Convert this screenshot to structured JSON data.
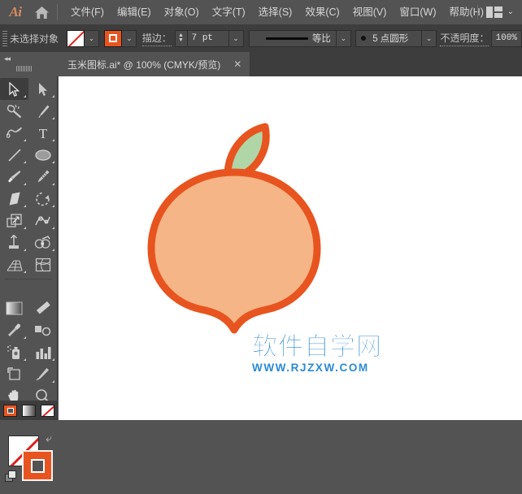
{
  "app": {
    "name": "Ai",
    "logo_color": "#d98b5f",
    "ui_bg": "#535353",
    "panel_bg": "#3d3d3d",
    "accent_orange": "#e8541f"
  },
  "menubar": {
    "home_icon": "home-icon",
    "items": [
      {
        "label": "文件(F)"
      },
      {
        "label": "编辑(E)"
      },
      {
        "label": "对象(O)"
      },
      {
        "label": "文字(T)"
      },
      {
        "label": "选择(S)"
      },
      {
        "label": "效果(C)"
      },
      {
        "label": "视图(V)"
      },
      {
        "label": "窗口(W)"
      },
      {
        "label": "帮助(H)"
      }
    ],
    "workspace_icon": "workspace-switcher-icon",
    "workspace_chevron": "⌄"
  },
  "controlbar": {
    "selection_status": "未选择对象",
    "fill_swatch": {
      "name": "fill-none",
      "value": "无"
    },
    "fill_dropdown": "⌄",
    "stroke_swatch": {
      "name": "stroke-orange",
      "value": "#e8541f"
    },
    "stroke_dropdown": "⌄",
    "stroke_label": "描边：",
    "stroke_weight": "7 pt",
    "stroke_weight_dropdown": "⌄",
    "profile_label": "等比",
    "profile_dropdown": "⌄",
    "brush_label": "5 点圆形",
    "brush_dropdown": "⌄",
    "opacity_label": "不透明度：",
    "opacity_value": "100%"
  },
  "tabbar": {
    "collapse_arrows": "◂◂",
    "document_tab": {
      "title": "玉米图标.ai* @ 100% (CMYK/预览)",
      "close": "✕"
    }
  },
  "toolpanel": {
    "tools": [
      {
        "name": "selection-tool",
        "label": "选择工具",
        "active": true,
        "has_flyout": true
      },
      {
        "name": "direct-selection-tool",
        "label": "直接选择工具",
        "active": false,
        "has_flyout": true
      },
      {
        "name": "magic-wand-tool",
        "label": "魔棒工具",
        "active": false,
        "has_flyout": false
      },
      {
        "name": "pen-tool",
        "label": "钢笔工具",
        "active": false,
        "has_flyout": true
      },
      {
        "name": "curvature-tool",
        "label": "曲率工具",
        "active": false,
        "has_flyout": true
      },
      {
        "name": "type-tool",
        "label": "文字工具",
        "active": false,
        "has_flyout": true
      },
      {
        "name": "line-segment-tool",
        "label": "直线段工具",
        "active": false,
        "has_flyout": true
      },
      {
        "name": "ellipse-tool",
        "label": "椭圆工具",
        "active": false,
        "has_flyout": true
      },
      {
        "name": "paintbrush-tool",
        "label": "画笔工具",
        "active": false,
        "has_flyout": true
      },
      {
        "name": "pencil-tool",
        "label": "铅笔工具",
        "active": false,
        "has_flyout": true
      },
      {
        "name": "eraser-tool",
        "label": "橡皮擦工具",
        "active": false,
        "has_flyout": true
      },
      {
        "name": "rotate-tool",
        "label": "旋转工具",
        "active": false,
        "has_flyout": true
      },
      {
        "name": "scale-tool",
        "label": "比例缩放工具",
        "active": false,
        "has_flyout": true
      },
      {
        "name": "width-tool",
        "label": "宽度工具",
        "active": false,
        "has_flyout": true
      },
      {
        "name": "free-transform-tool",
        "label": "自由变换工具",
        "active": false,
        "has_flyout": true
      },
      {
        "name": "shape-builder-tool",
        "label": "形状生成器工具",
        "active": false,
        "has_flyout": true
      },
      {
        "name": "perspective-grid-tool",
        "label": "透视网格工具",
        "active": false,
        "has_flyout": true
      },
      {
        "name": "mesh-tool",
        "label": "网格工具",
        "active": false,
        "has_flyout": false
      },
      {
        "name": "gradient-tool",
        "label": "渐变工具",
        "active": false,
        "has_flyout": false
      },
      {
        "name": "measure-tool",
        "label": "度量工具",
        "active": false,
        "has_flyout": false
      },
      {
        "name": "eyedropper-tool",
        "label": "吸管工具",
        "active": false,
        "has_flyout": true
      },
      {
        "name": "blend-tool",
        "label": "混合工具",
        "active": false,
        "has_flyout": false
      },
      {
        "name": "symbol-sprayer-tool",
        "label": "符号喷枪工具",
        "active": false,
        "has_flyout": true
      },
      {
        "name": "column-graph-tool",
        "label": "柱形图工具",
        "active": false,
        "has_flyout": true
      },
      {
        "name": "artboard-tool",
        "label": "画板工具",
        "active": false,
        "has_flyout": false
      },
      {
        "name": "slice-tool",
        "label": "切片工具",
        "active": false,
        "has_flyout": true
      },
      {
        "name": "hand-tool",
        "label": "抓手工具",
        "active": false,
        "has_flyout": true
      },
      {
        "name": "zoom-tool",
        "label": "缩放工具",
        "active": false,
        "has_flyout": false
      }
    ],
    "color_controls": {
      "fill": {
        "name": "fill-swatch",
        "value": "无"
      },
      "stroke": {
        "name": "stroke-swatch",
        "value": "#e8541f"
      },
      "swap_icon": "⤶",
      "default_icon": "default-fill-stroke-icon"
    },
    "mode_buttons": [
      {
        "name": "color-mode-button",
        "label": "颜色"
      },
      {
        "name": "gradient-mode-button",
        "label": "渐变"
      },
      {
        "name": "none-mode-button",
        "label": "无"
      }
    ]
  },
  "canvas": {
    "background": "#ffffff",
    "artwork": {
      "name": "peach-illustration",
      "body_fill": "#f5b586",
      "leaf_fill": "#b0d6a8",
      "stroke": "#e8541f",
      "stroke_width": "7 pt"
    },
    "watermark": {
      "main": "软件自学网",
      "sub": "WWW.RJZXW.COM",
      "color": "#1a7fd4"
    }
  }
}
